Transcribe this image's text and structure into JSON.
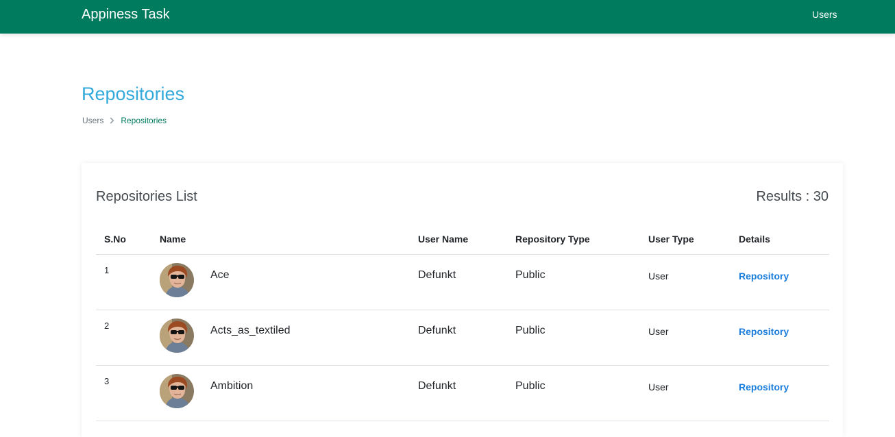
{
  "navbar": {
    "brand": "Appiness Task",
    "users_link": "Users",
    "background": "#007b5e"
  },
  "page": {
    "title": "Repositories",
    "title_color": "#33a9dc"
  },
  "breadcrumb": {
    "items": [
      "Users",
      "Repositories"
    ],
    "separator_icon": "chevron-right-icon"
  },
  "card": {
    "title": "Repositories List",
    "results": "Results : 30"
  },
  "table": {
    "headers": [
      "S.No",
      "Name",
      "User Name",
      "Repository Type",
      "User Type",
      "Details"
    ],
    "rows": [
      {
        "sno": "1",
        "name": "Ace",
        "user_name": "Defunkt",
        "repository_type": "Public",
        "user_type": "User",
        "details": "Repository",
        "avatar_icon": "user-avatar"
      },
      {
        "sno": "2",
        "name": "Acts_as_textiled",
        "user_name": "Defunkt",
        "repository_type": "Public",
        "user_type": "User",
        "details": "Repository",
        "avatar_icon": "user-avatar"
      },
      {
        "sno": "3",
        "name": "Ambition",
        "user_name": "Defunkt",
        "repository_type": "Public",
        "user_type": "User",
        "details": "Repository",
        "avatar_icon": "user-avatar"
      }
    ],
    "link_color": "#1a7ddb"
  }
}
